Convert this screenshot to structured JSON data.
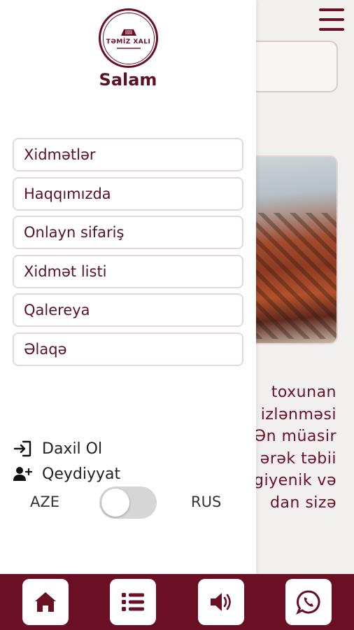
{
  "app": {
    "brand_name": "TƏMİZ XALI",
    "colors": {
      "primary": "#6b0f24",
      "text": "#5a1224",
      "border": "#e7d7da"
    }
  },
  "drawer": {
    "greeting": "Salam",
    "menu": [
      {
        "label": "Xidmətlər"
      },
      {
        "label": "Haqqımızda"
      },
      {
        "label": "Onlayn sifariş"
      },
      {
        "label": "Xidmət listi"
      },
      {
        "label": "Qalereya"
      },
      {
        "label": "Əlaqə"
      }
    ],
    "login_label": "Daxil Ol",
    "register_label": "Qeydiyyat",
    "lang_left": "AZE",
    "lang_right": "RUS",
    "lang_toggle_on": false
  },
  "background_page": {
    "text_fragments": [
      "toxunan",
      "izlənməsi",
      "Ən müasir",
      "ərək təbii",
      "giyenik və",
      "dan sizə"
    ]
  },
  "bottom_bar": {
    "icons": [
      "home-icon",
      "list-icon",
      "volume-icon",
      "whatsapp-icon"
    ]
  }
}
